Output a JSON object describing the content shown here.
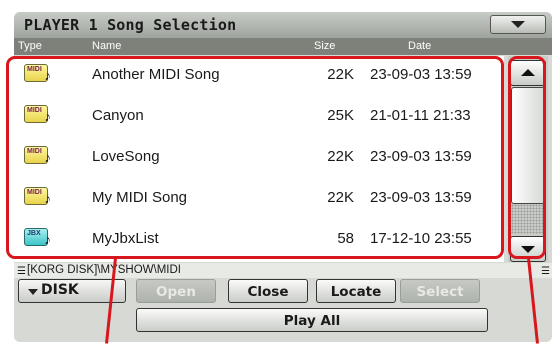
{
  "window": {
    "title": "PLAYER 1 Song Selection"
  },
  "columns": {
    "type": "Type",
    "name": "Name",
    "size": "Size",
    "date": "Date"
  },
  "files": [
    {
      "type": "MIDI",
      "name": "Another MIDI Song",
      "size": "22K",
      "date": "23-09-03 13:59"
    },
    {
      "type": "MIDI",
      "name": "Canyon",
      "size": "25K",
      "date": "21-01-11 21:33"
    },
    {
      "type": "MIDI",
      "name": "LoveSong",
      "size": "22K",
      "date": "23-09-03 13:59"
    },
    {
      "type": "MIDI",
      "name": "My MIDI Song",
      "size": "22K",
      "date": "23-09-03 13:59"
    },
    {
      "type": "JBX",
      "name": "MyJbxList",
      "size": "58",
      "date": "17-12-10 23:55"
    }
  ],
  "path": "[KORG DISK]\\MYSHOW\\MIDI",
  "buttons": {
    "disk": "DISK",
    "open": "Open",
    "close": "Close",
    "locate": "Locate",
    "select": "Select",
    "play_all": "Play All"
  },
  "colors": {
    "annotation": "#d8161e",
    "header": "#7d8179",
    "midi_icon": "#e8d34a",
    "jbx_icon": "#3cc4c8"
  },
  "icons": {
    "menu": "chevron-down-icon",
    "scroll_up": "arrow-up-icon",
    "scroll_down": "arrow-down-icon",
    "midi_file": "midi-file-icon",
    "jbx_file": "jbx-file-icon"
  }
}
